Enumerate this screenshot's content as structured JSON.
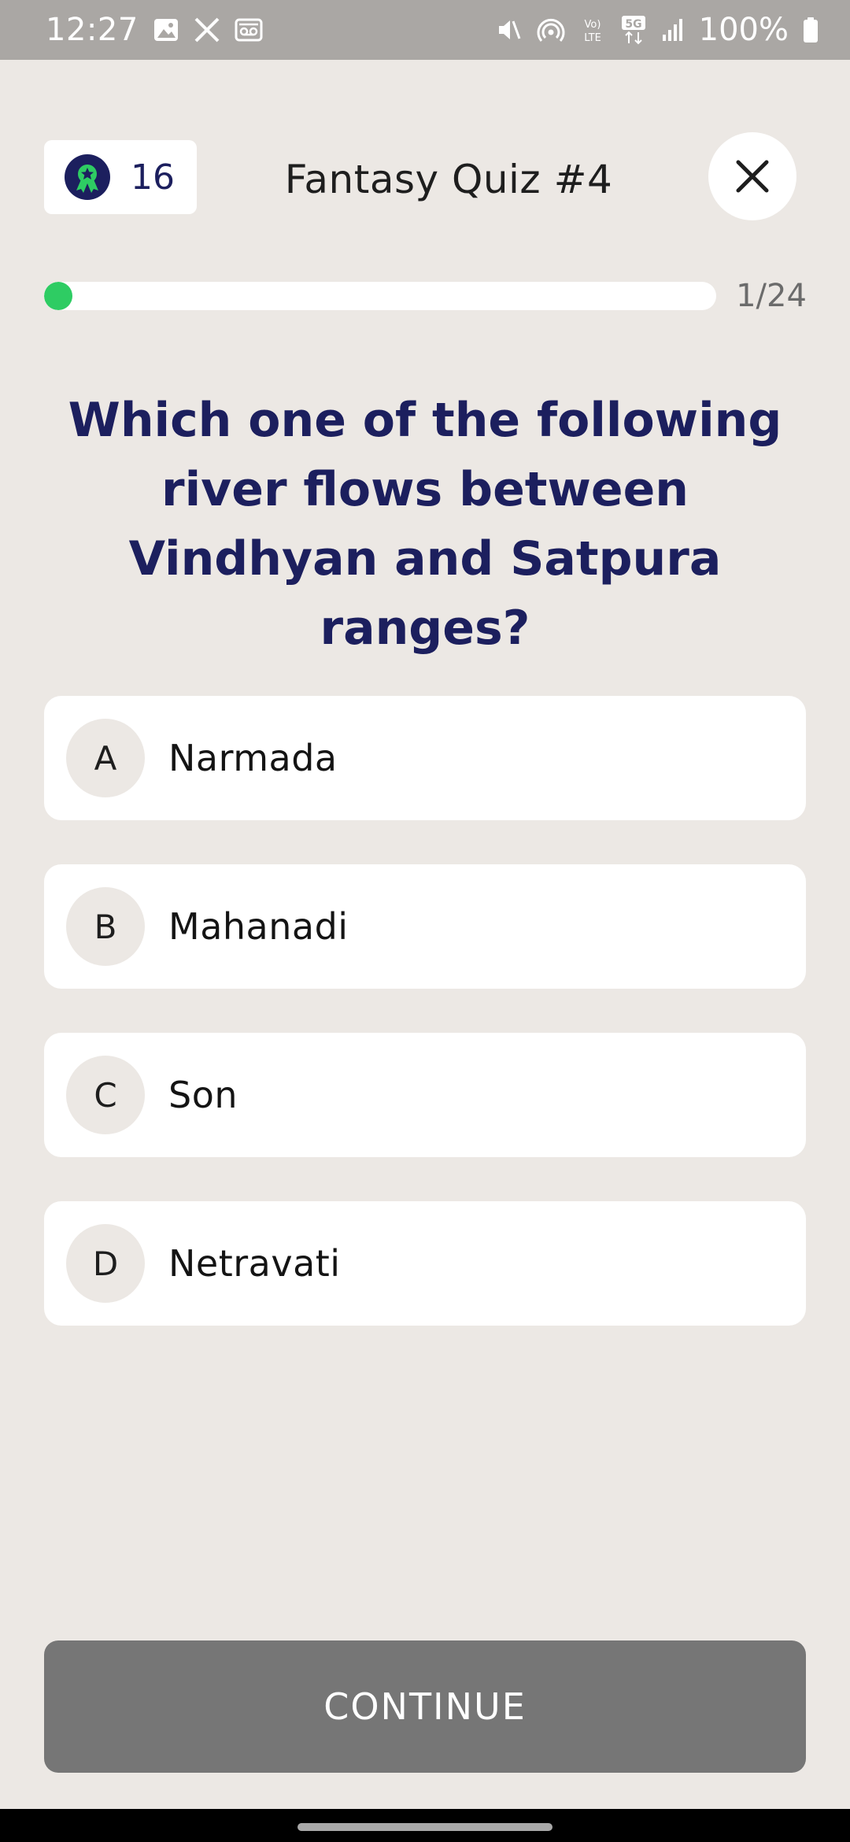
{
  "status_bar": {
    "time": "12:27",
    "battery": "100%",
    "left_icons": [
      "gallery-icon",
      "x-icon",
      "voicemail-icon"
    ],
    "right_icons": [
      "mute-icon",
      "hotspot-icon",
      "volte-icon",
      "5g-icon",
      "signal-icon",
      "battery-icon"
    ]
  },
  "header": {
    "score": "16",
    "title": "Fantasy Quiz #4"
  },
  "progress": {
    "label": "1/24",
    "fraction": 0.0417,
    "color": "#2ecc63"
  },
  "question": "Which one of the following river flows between Vindhyan and Satpura ranges?",
  "options": [
    {
      "letter": "A",
      "text": "Narmada"
    },
    {
      "letter": "B",
      "text": "Mahanadi"
    },
    {
      "letter": "C",
      "text": "Son"
    },
    {
      "letter": "D",
      "text": "Netravati"
    }
  ],
  "continue_label": "CONTINUE",
  "colors": {
    "background": "#ece8e4",
    "question_text": "#1c1f5e",
    "continue_button": "#767676",
    "accent_green": "#2ecc63"
  }
}
